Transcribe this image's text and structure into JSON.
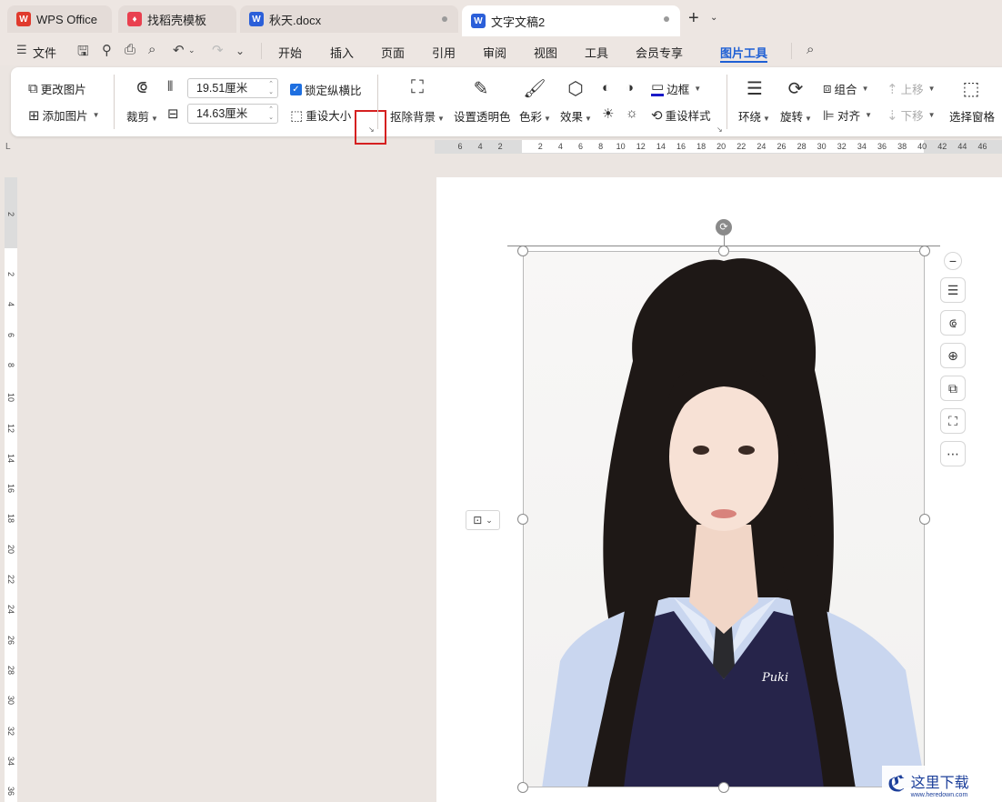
{
  "tabs": [
    {
      "label": "WPS Office",
      "icon": "wps-logo-icon",
      "color": "#e03a2d"
    },
    {
      "label": "找稻壳模板",
      "icon": "docer-icon",
      "color": "#e9404f"
    },
    {
      "label": "秋天.docx",
      "icon": "word-doc-icon",
      "color": "#2b5fd9"
    },
    {
      "label": "文字文稿2",
      "icon": "word-doc-icon",
      "color": "#2b5fd9"
    }
  ],
  "menu": {
    "file": "文件",
    "items": [
      "开始",
      "插入",
      "页面",
      "引用",
      "审阅",
      "视图",
      "工具",
      "会员专享",
      "图片工具"
    ],
    "active": "图片工具",
    "accent": "#1e5fd4"
  },
  "ribbon": {
    "change_picture": "更改图片",
    "add_picture": "添加图片",
    "crop": "裁剪",
    "width": "19.51厘米",
    "height": "14.63厘米",
    "lock_ratio": "锁定纵横比",
    "reset_size": "重设大小",
    "remove_bg": "抠除背景",
    "set_transparent": "设置透明色",
    "color": "色彩",
    "effects": "效果",
    "border": "边框",
    "reset_style": "重设样式",
    "wrap": "环绕",
    "rotate": "旋转",
    "group": "组合",
    "align": "对齐",
    "bring_forward": "上移",
    "send_backward": "下移",
    "selection_pane": "选择窗格"
  },
  "ruler": {
    "h_ticks": [
      "6",
      "4",
      "2",
      "2",
      "4",
      "6",
      "8",
      "10",
      "12",
      "14",
      "16",
      "18",
      "20",
      "22",
      "24",
      "26",
      "28",
      "30",
      "32",
      "34",
      "36",
      "38",
      "40",
      "42",
      "44",
      "46"
    ],
    "v_ticks": [
      "2",
      "2",
      "4",
      "6",
      "8",
      "10",
      "12",
      "14",
      "16",
      "18",
      "20",
      "22",
      "24",
      "26",
      "28",
      "30",
      "32",
      "34",
      "36"
    ]
  },
  "watermark": {
    "brand": "这里下载",
    "url": "www.heredown.com"
  }
}
